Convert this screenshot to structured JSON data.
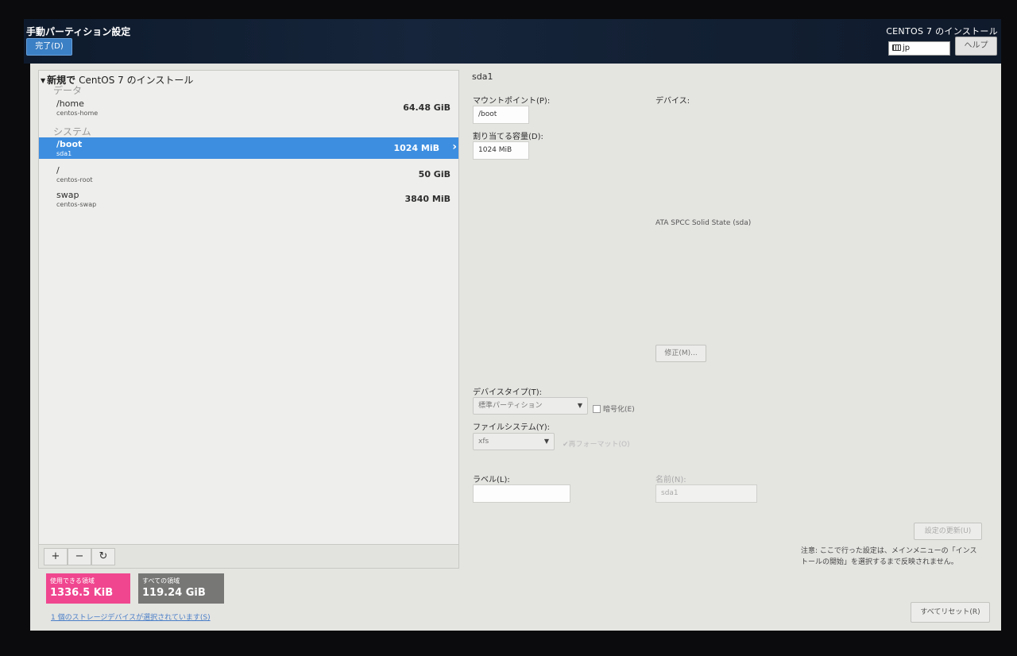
{
  "header": {
    "title": "手動パーティション設定",
    "done_label": "完了(D)",
    "product": "CENTOS 7 のインストール",
    "keyboard": "jp",
    "help_label": "ヘルプ"
  },
  "tree": {
    "root_prefix": "新規で",
    "root_label": "CentOS 7 のインストール",
    "categories": {
      "data": "データ",
      "system": "システム"
    },
    "items": [
      {
        "mount": "/home",
        "device": "centos-home",
        "size": "64.48 GiB"
      },
      {
        "mount": "/boot",
        "device": "sda1",
        "size": "1024 MiB"
      },
      {
        "mount": "/",
        "device": "centos-root",
        "size": "50 GiB"
      },
      {
        "mount": "swap",
        "device": "centos-swap",
        "size": "3840 MiB"
      }
    ]
  },
  "toolbar": {
    "add": "+",
    "remove": "−",
    "refresh": "↻"
  },
  "space": {
    "available_label": "使用できる領域",
    "available_value": "1336.5 KiB",
    "total_label": "すべての領域",
    "total_value": "119.24 GiB"
  },
  "storage_link": "1 個のストレージデバイスが選択されています(S)",
  "details": {
    "title": "sda1",
    "mount_label": "マウントポイント(P):",
    "mount_value": "/boot",
    "capacity_label": "割り当てる容量(D):",
    "capacity_value": "1024 MiB",
    "devices_label": "デバイス:",
    "device_name": "ATA SPCC Solid State (sda)",
    "modify_label": "修正(M)...",
    "device_type_label": "デバイスタイプ(T):",
    "device_type_value": "標準パーティション",
    "encrypt_label": "暗号化(E)",
    "filesystem_label": "ファイルシステム(Y):",
    "filesystem_value": "xfs",
    "reformat_label": "再フォーマット(O)",
    "label_label": "ラベル(L):",
    "label_value": "",
    "name_label": "名前(N):",
    "name_value": "sda1",
    "update_label": "設定の更新(U)"
  },
  "note": "注意: ここで行った設定は、メインメニューの「インストールの開始」を選択するまで反映されません。",
  "reset_label": "すべてリセット(R)"
}
